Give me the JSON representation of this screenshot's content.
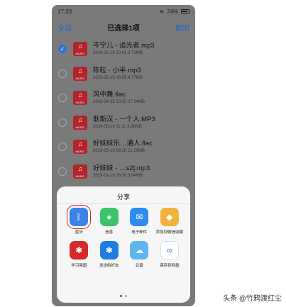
{
  "status_bar": {
    "time": "17:33",
    "battery": "74%"
  },
  "header": {
    "select_all": "全选",
    "title": "已选择1项",
    "cancel": "取消"
  },
  "files": [
    {
      "name": "岑宁儿 - 追光者.mp3",
      "meta": "2019-05-19 10:01   3.71MB",
      "checked": true
    },
    {
      "name": "陈粒 - 小半.mp3",
      "meta": "2019-05-19 16:59   4.77MB",
      "checked": false
    },
    {
      "name": "风中舞.flac",
      "meta": "2018-04-25 20:25   37.64MB",
      "checked": false
    },
    {
      "name": "耿斯汉 - 一个人.MP3",
      "meta": "2019-05-19 11:11   9.88MB",
      "checked": false
    },
    {
      "name": "好妹妹乐…通人.flac",
      "meta": "2019-05-19 09:28   21.20MB",
      "checked": false
    },
    {
      "name": "好妹妹 - …s2].mp3",
      "meta": "2019-01-16 08:36   3.94MB",
      "checked": false
    }
  ],
  "file_icon_label": "MUSIC",
  "share_sheet": {
    "title": "分享",
    "apps": [
      {
        "label": "蓝牙",
        "icon": "bluetooth-icon",
        "color": "#3b82e8",
        "glyph": "ᛒ"
      },
      {
        "label": "信息",
        "icon": "message-icon",
        "color": "#3cc46a",
        "glyph": "●"
      },
      {
        "label": "电子邮件",
        "icon": "mail-icon",
        "color": "#2e8cf0",
        "glyph": "✉"
      },
      {
        "label": "添加到微信收藏",
        "icon": "wechat-favorites-icon",
        "color": "#f2b33d",
        "glyph": "◆"
      },
      {
        "label": "学习强国",
        "icon": "xuexi-qiangguo-icon",
        "color": "#d42a2a",
        "glyph": "✱"
      },
      {
        "label": "发送给好友",
        "icon": "send-to-friend-icon",
        "color": "#1e7de0",
        "glyph": "✱"
      },
      {
        "label": "云盘",
        "icon": "cloud-drive-icon",
        "color": "#5cb6f0",
        "glyph": "☁"
      },
      {
        "label": "保存到网盘",
        "icon": "baidu-netdisk-icon",
        "color": "#ffffff",
        "glyph": "∞"
      }
    ],
    "page_count": 2,
    "active_page": 1
  },
  "watermark": "头条 @竹鸦渡红尘"
}
